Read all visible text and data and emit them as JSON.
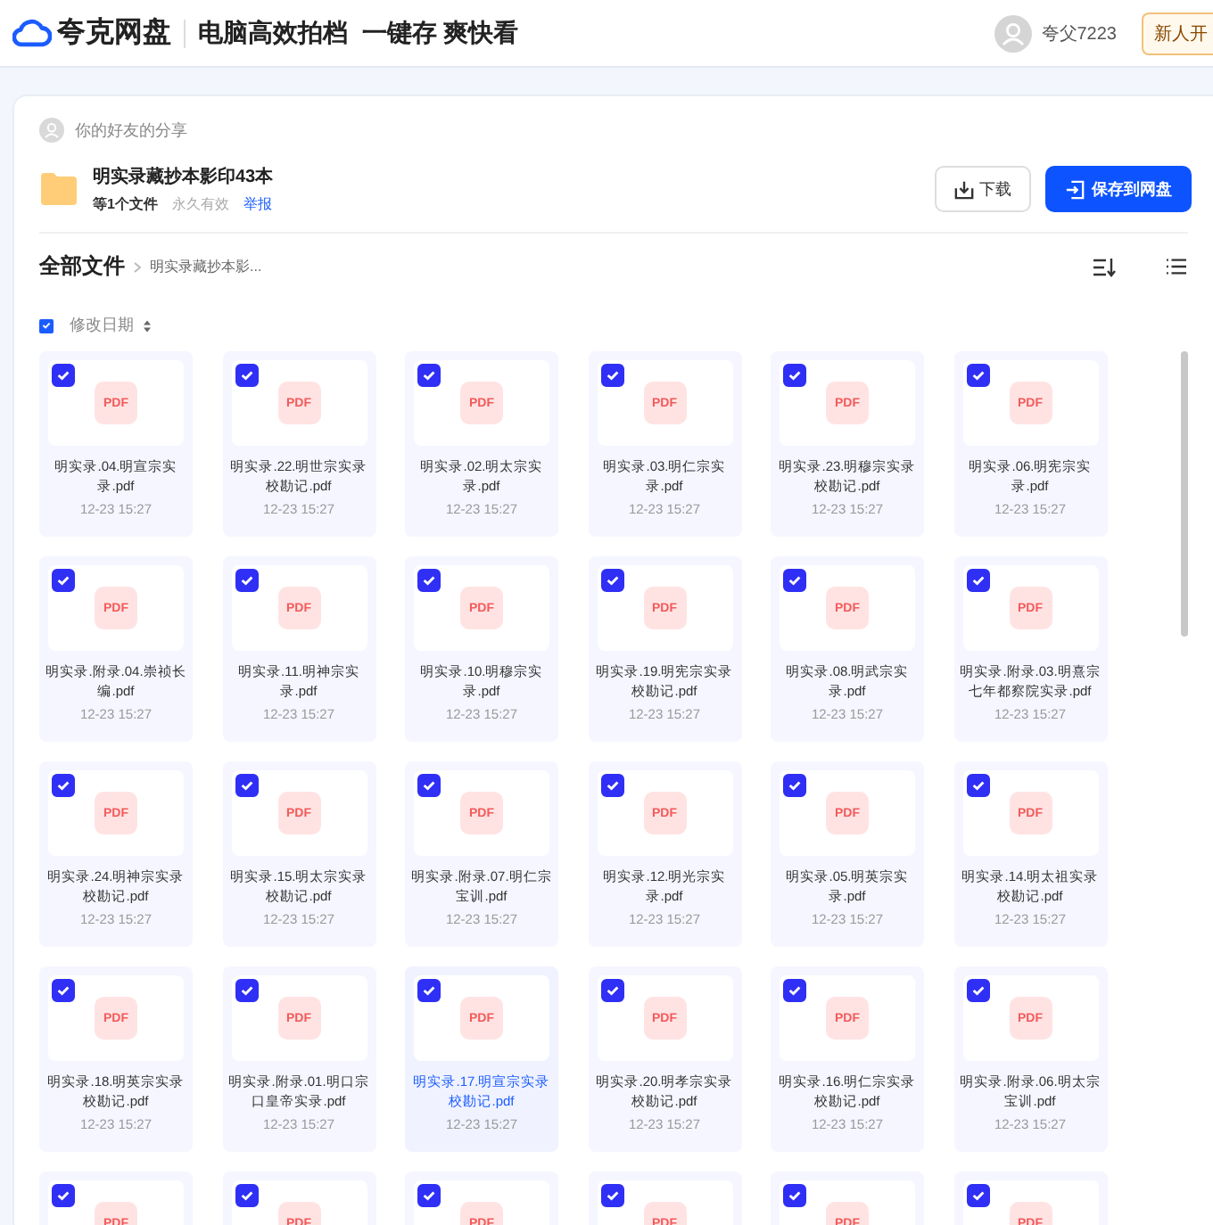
{
  "header": {
    "logo": "夸克网盘",
    "slogan": "电脑高效拍档  一键存 爽快看",
    "username": "夸父7223",
    "promo_button": "新人开"
  },
  "share": {
    "from_label": "你的好友的分享",
    "title": "明实录藏抄本影印43本",
    "count": "等1个文件",
    "validity": "永久有效",
    "report_link": "举报",
    "download_button": "下载",
    "save_button": "保存到网盘"
  },
  "breadcrumb": {
    "root": "全部文件",
    "current": "明实录藏抄本影..."
  },
  "list_header": {
    "select_all_checked": true,
    "sort_label": "修改日期"
  },
  "files": [
    {
      "type_label": "PDF",
      "name": "明实录.04.明宣宗实录.pdf",
      "date": "12-23 15:27",
      "checked": true,
      "hovered": false
    },
    {
      "type_label": "PDF",
      "name": "明实录.22.明世宗实录校勘记.pdf",
      "date": "12-23 15:27",
      "checked": true,
      "hovered": false
    },
    {
      "type_label": "PDF",
      "name": "明实录.02.明太宗实录.pdf",
      "date": "12-23 15:27",
      "checked": true,
      "hovered": false
    },
    {
      "type_label": "PDF",
      "name": "明实录.03.明仁宗实录.pdf",
      "date": "12-23 15:27",
      "checked": true,
      "hovered": false
    },
    {
      "type_label": "PDF",
      "name": "明实录.23.明穆宗实录校勘记.pdf",
      "date": "12-23 15:27",
      "checked": true,
      "hovered": false
    },
    {
      "type_label": "PDF",
      "name": "明实录.06.明宪宗实录.pdf",
      "date": "12-23 15:27",
      "checked": true,
      "hovered": false
    },
    {
      "type_label": "PDF",
      "name": "明实录.附录.04.崇祯长编.pdf",
      "date": "12-23 15:27",
      "checked": true,
      "hovered": false
    },
    {
      "type_label": "PDF",
      "name": "明实录.11.明神宗实录.pdf",
      "date": "12-23 15:27",
      "checked": true,
      "hovered": false
    },
    {
      "type_label": "PDF",
      "name": "明实录.10.明穆宗实录.pdf",
      "date": "12-23 15:27",
      "checked": true,
      "hovered": false
    },
    {
      "type_label": "PDF",
      "name": "明实录.19.明宪宗实录校勘记.pdf",
      "date": "12-23 15:27",
      "checked": true,
      "hovered": false
    },
    {
      "type_label": "PDF",
      "name": "明实录.08.明武宗实录.pdf",
      "date": "12-23 15:27",
      "checked": true,
      "hovered": false
    },
    {
      "type_label": "PDF",
      "name": "明实录.附录.03.明熹宗七年都察院实录.pdf",
      "date": "12-23 15:27",
      "checked": true,
      "hovered": false
    },
    {
      "type_label": "PDF",
      "name": "明实录.24.明神宗实录校勘记.pdf",
      "date": "12-23 15:27",
      "checked": true,
      "hovered": false
    },
    {
      "type_label": "PDF",
      "name": "明实录.15.明太宗实录校勘记.pdf",
      "date": "12-23 15:27",
      "checked": true,
      "hovered": false
    },
    {
      "type_label": "PDF",
      "name": "明实录.附录.07.明仁宗宝训.pdf",
      "date": "12-23 15:27",
      "checked": true,
      "hovered": false
    },
    {
      "type_label": "PDF",
      "name": "明实录.12.明光宗实录.pdf",
      "date": "12-23 15:27",
      "checked": true,
      "hovered": false
    },
    {
      "type_label": "PDF",
      "name": "明实录.05.明英宗实录.pdf",
      "date": "12-23 15:27",
      "checked": true,
      "hovered": false
    },
    {
      "type_label": "PDF",
      "name": "明实录.14.明太祖实录校勘记.pdf",
      "date": "12-23 15:27",
      "checked": true,
      "hovered": false
    },
    {
      "type_label": "PDF",
      "name": "明实录.18.明英宗实录校勘记.pdf",
      "date": "12-23 15:27",
      "checked": true,
      "hovered": false
    },
    {
      "type_label": "PDF",
      "name": "明实录.附录.01.明口宗口皇帝实录.pdf",
      "date": "12-23 15:27",
      "checked": true,
      "hovered": false
    },
    {
      "type_label": "PDF",
      "name": "明实录.17.明宣宗实录校勘记.pdf",
      "date": "12-23 15:27",
      "checked": true,
      "hovered": true
    },
    {
      "type_label": "PDF",
      "name": "明实录.20.明孝宗实录校勘记.pdf",
      "date": "12-23 15:27",
      "checked": true,
      "hovered": false
    },
    {
      "type_label": "PDF",
      "name": "明实录.16.明仁宗实录校勘记.pdf",
      "date": "12-23 15:27",
      "checked": true,
      "hovered": false
    },
    {
      "type_label": "PDF",
      "name": "明实录.附录.06.明太宗宝训.pdf",
      "date": "12-23 15:27",
      "checked": true,
      "hovered": false
    },
    {
      "type_label": "PDF",
      "checked": true,
      "hovered": false
    },
    {
      "type_label": "PDF",
      "checked": true,
      "hovered": false
    },
    {
      "type_label": "PDF",
      "checked": true,
      "hovered": false
    },
    {
      "type_label": "PDF",
      "checked": true,
      "hovered": false
    },
    {
      "type_label": "PDF",
      "checked": true,
      "hovered": false
    },
    {
      "type_label": "PDF",
      "checked": true,
      "hovered": false
    }
  ]
}
